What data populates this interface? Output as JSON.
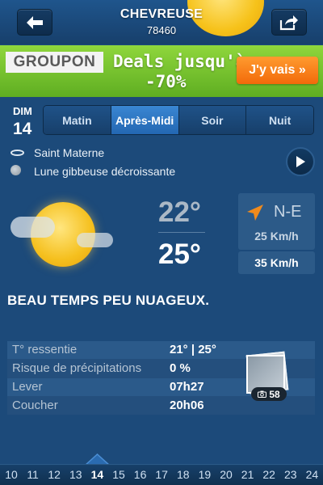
{
  "header": {
    "city": "CHEVREUSE",
    "postal_code": "78460",
    "back_icon": "arrow-left-icon",
    "share_icon": "share-icon"
  },
  "banner": {
    "brand": "GROUPON",
    "line1": "Deals jusqu'à",
    "line2": "-70%",
    "cta": "J'y vais »"
  },
  "day": {
    "label": "DIM",
    "number": "14"
  },
  "tabs": [
    {
      "label": "Matin",
      "active": false
    },
    {
      "label": "Après-Midi",
      "active": true
    },
    {
      "label": "Soir",
      "active": false
    },
    {
      "label": "Nuit",
      "active": false
    }
  ],
  "info": {
    "saint": "Saint Materne",
    "moon": "Lune gibbeuse décroissante"
  },
  "weather": {
    "icon": "sun-with-clouds-icon",
    "temp_low": "22°",
    "temp_high": "25°",
    "wind_direction": "N-E",
    "wind_speed": "25 Km/h",
    "gusts": "35 Km/h",
    "description": "BEAU TEMPS PEU NUAGEUX."
  },
  "details": [
    {
      "label": "T° ressentie",
      "value": "21° | 25°"
    },
    {
      "label": "Risque de précipitations",
      "value": "0 %"
    },
    {
      "label": "Lever",
      "value": "07h27"
    },
    {
      "label": "Coucher",
      "value": "20h06"
    }
  ],
  "photos": {
    "count": "58"
  },
  "days_strip": [
    "10",
    "11",
    "12",
    "13",
    "14",
    "15",
    "16",
    "17",
    "18",
    "19",
    "20",
    "21",
    "22",
    "23",
    "24"
  ],
  "days_strip_active": "14",
  "colors": {
    "background": "#1c4a7a",
    "tab_active": "#2e78c8",
    "accent_orange": "#f26a0a",
    "sun": "#f5c01e"
  }
}
